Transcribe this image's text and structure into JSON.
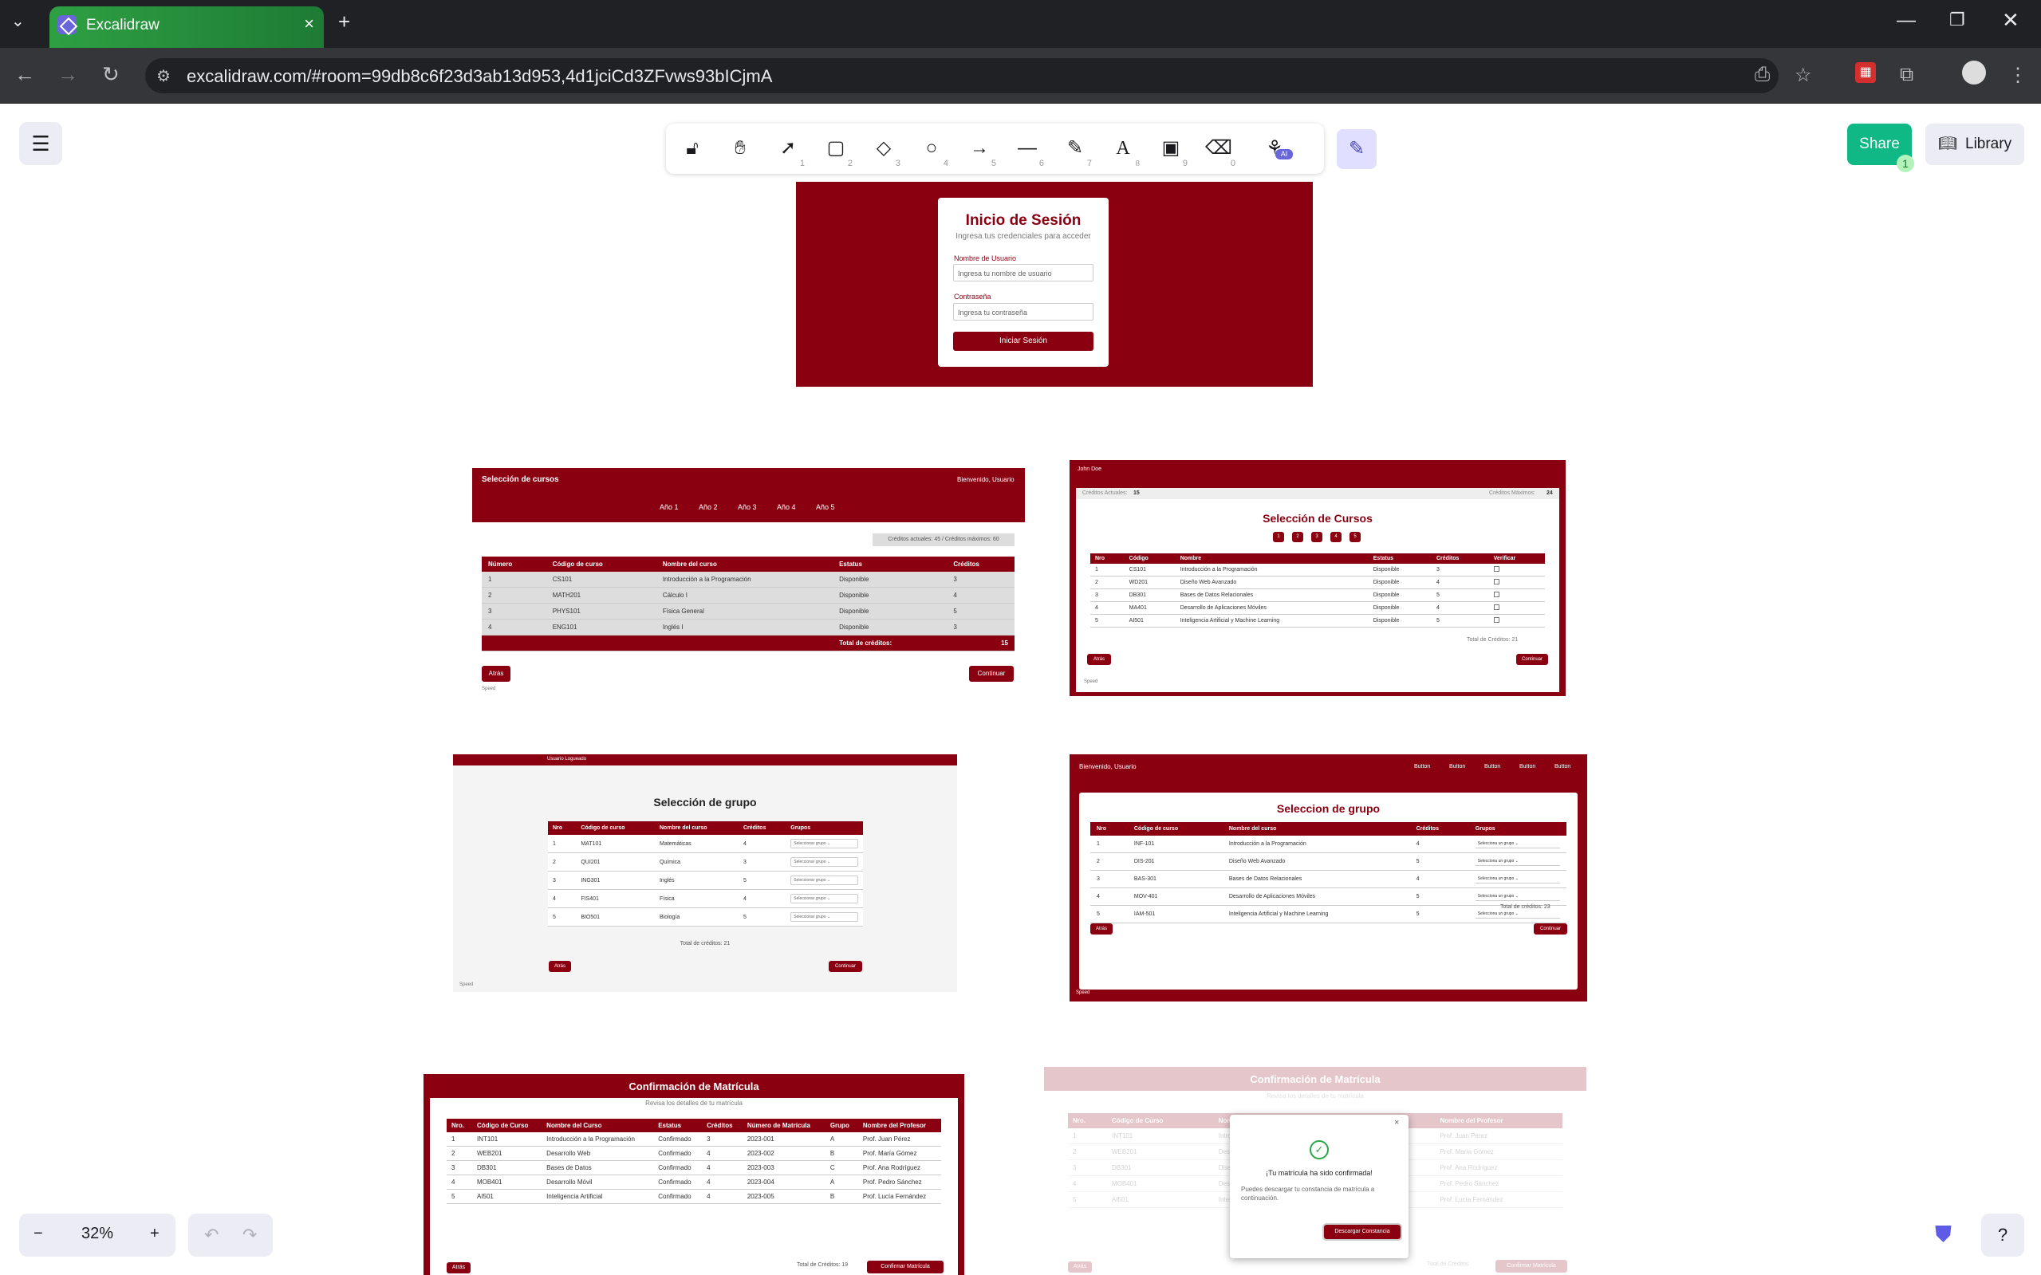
{
  "browser": {
    "tab_title": "Excalidraw",
    "url": "excalidraw.com/#room=99db8c6f23d3ab13d953,4d1jciCd3ZFvws93bICjmA"
  },
  "excalidraw": {
    "share_label": "Share",
    "share_badge": "1",
    "library_label": "Library",
    "zoom": "32%",
    "ai_badge": "AI",
    "tool_keys": [
      "1",
      "2",
      "3",
      "4",
      "5",
      "6",
      "7",
      "8",
      "9",
      "0"
    ]
  },
  "login": {
    "title": "Inicio de Sesión",
    "subtitle": "Ingresa tus credenciales para acceder",
    "user_label": "Nombre de Usuario",
    "user_placeholder": "Ingresa tu nombre de usuario",
    "pass_label": "Contraseña",
    "pass_placeholder": "Ingresa tu contraseña",
    "button": "Iniciar Sesión"
  },
  "f1": {
    "title": "Selección de cursos",
    "welcome": "Bienvenido, Usuario",
    "years": [
      "Año 1",
      "Año 2",
      "Año 3",
      "Año 4",
      "Año 5"
    ],
    "credits_box": "Créditos actuales: 45 / Créditos máximos: 60",
    "headers": [
      "Número",
      "Código de curso",
      "Nombre del curso",
      "Estatus",
      "Créditos"
    ],
    "rows": [
      [
        "1",
        "CS101",
        "Introducción a la Programación",
        "Disponible",
        "3"
      ],
      [
        "2",
        "MATH201",
        "Cálculo I",
        "Disponible",
        "4"
      ],
      [
        "3",
        "PHYS101",
        "Física General",
        "Disponible",
        "5"
      ],
      [
        "4",
        "ENG101",
        "Inglés I",
        "Disponible",
        "3"
      ]
    ],
    "total_label": "Total de créditos:",
    "total_value": "15",
    "back": "Atrás",
    "next": "Continuar",
    "speed": "Speed"
  },
  "f2": {
    "user": "John Doe",
    "cur_label": "Créditos Actuales:",
    "cur_value": "15",
    "max_label": "Créditos Máximos:",
    "max_value": "24",
    "title": "Selección de Cursos",
    "pages": [
      "1",
      "2",
      "3",
      "4",
      "5"
    ],
    "headers": [
      "Nro",
      "Código",
      "Nombre",
      "Estatus",
      "Créditos",
      "Verificar"
    ],
    "rows": [
      [
        "1",
        "CS101",
        "Introducción a la Programación",
        "Disponible",
        "3"
      ],
      [
        "2",
        "WD201",
        "Diseño Web Avanzado",
        "Disponible",
        "4"
      ],
      [
        "3",
        "DB301",
        "Bases de Datos Relacionales",
        "Disponible",
        "5"
      ],
      [
        "4",
        "MA401",
        "Desarrollo de Aplicaciones Móviles",
        "Disponible",
        "4"
      ],
      [
        "5",
        "AI501",
        "Inteligencia Artificial y Machine Learning",
        "Disponible",
        "5"
      ]
    ],
    "total": "Total de Créditos: 21",
    "back": "Atrás",
    "next": "Continuar",
    "speed": "Speed"
  },
  "f3": {
    "user": "Usuario Logueado",
    "title": "Selección de grupo",
    "headers": [
      "Nro",
      "Código de curso",
      "Nombre del curso",
      "Créditos",
      "Grupos"
    ],
    "rows": [
      [
        "1",
        "MAT101",
        "Matemáticas",
        "4"
      ],
      [
        "2",
        "QUI201",
        "Química",
        "3"
      ],
      [
        "3",
        "ING301",
        "Inglés",
        "5"
      ],
      [
        "4",
        "FIS401",
        "Física",
        "4"
      ],
      [
        "5",
        "BIO501",
        "Biología",
        "5"
      ]
    ],
    "select_placeholder": "Seleccionar grupo",
    "total": "Total de créditos: 21",
    "back": "Atrás",
    "next": "Continuar",
    "speed": "Speed"
  },
  "f4": {
    "welcome": "Bienvenido, Usuario",
    "nav": [
      "Button",
      "Button",
      "Button",
      "Button",
      "Button"
    ],
    "title": "Seleccion de grupo",
    "headers": [
      "Nro",
      "Código de curso",
      "Nombre del curso",
      "Créditos",
      "Grupos"
    ],
    "rows": [
      [
        "1",
        "INF-101",
        "Introducción a la Programación",
        "4"
      ],
      [
        "2",
        "DIS-201",
        "Diseño Web Avanzado",
        "5"
      ],
      [
        "3",
        "BAS-301",
        "Bases de Datos Relacionales",
        "4"
      ],
      [
        "4",
        "MOV-401",
        "Desarrollo de Aplicaciones Móviles",
        "5"
      ],
      [
        "5",
        "IAM-501",
        "Inteligencia Artificial y Machine Learning",
        "5"
      ]
    ],
    "select_placeholder": "Selecciona un grupo",
    "total": "Total de créditos: 23",
    "back": "Atrás",
    "next": "Continuar",
    "speed": "Speed"
  },
  "f5": {
    "title": "Confirmación de Matrícula",
    "subtitle": "Revisa los detalles de tu matrícula",
    "headers": [
      "Nro.",
      "Código de Curso",
      "Nombre del Curso",
      "Estatus",
      "Créditos",
      "Número de Matrícula",
      "Grupo",
      "Nombre del Profesor"
    ],
    "rows": [
      [
        "1",
        "INT101",
        "Introducción a la Programación",
        "Confirmado",
        "3",
        "2023-001",
        "A",
        "Prof. Juan Pérez"
      ],
      [
        "2",
        "WEB201",
        "Desarrollo Web",
        "Confirmado",
        "4",
        "2023-002",
        "B",
        "Prof. María Gómez"
      ],
      [
        "3",
        "DB301",
        "Bases de Datos",
        "Confirmado",
        "4",
        "2023-003",
        "C",
        "Prof. Ana Rodríguez"
      ],
      [
        "4",
        "MOB401",
        "Desarrollo Móvil",
        "Confirmado",
        "4",
        "2023-004",
        "A",
        "Prof. Pedro Sánchez"
      ],
      [
        "5",
        "AI501",
        "Inteligencia Artificial",
        "Confirmado",
        "4",
        "2023-005",
        "B",
        "Prof. Lucía Fernández"
      ]
    ],
    "back": "Atrás",
    "total": "Total de Créditos: 19",
    "confirm": "Confirmar Matrícula"
  },
  "f6": {
    "title": "Confirmación de Matrícula",
    "subtitle": "Revisa los detalles de tu matrícula",
    "headers": [
      "Nro.",
      "Código de Curso",
      "Nombre del",
      "Grupo",
      "Nombre del Profesor"
    ],
    "rows": [
      [
        "1",
        "INT101",
        "Introducción a la Programación",
        "A",
        "Prof. Juan Pérez"
      ],
      [
        "2",
        "WEB201",
        "Desarrollo Web",
        "B",
        "Prof. María Gómez"
      ],
      [
        "3",
        "DB301",
        "Diseño de Datos",
        "C",
        "Prof. Ana Rodríguez"
      ],
      [
        "4",
        "MOB401",
        "Desarrollo Móvil",
        "A",
        "Prof. Pedro Sánchez"
      ],
      [
        "5",
        "AI501",
        "Inteligencia Artificial",
        "B",
        "Prof. Lucía Fernández"
      ]
    ],
    "modal_title": "¡Tu matrícula ha sido confirmada!",
    "modal_text": "Puedes descargar tu constancia de matrícula a continuación.",
    "modal_button": "Descargar Constancia",
    "back": "Atrás",
    "total": "Total de Créditos",
    "confirm": "Confirmar Matrícula"
  }
}
